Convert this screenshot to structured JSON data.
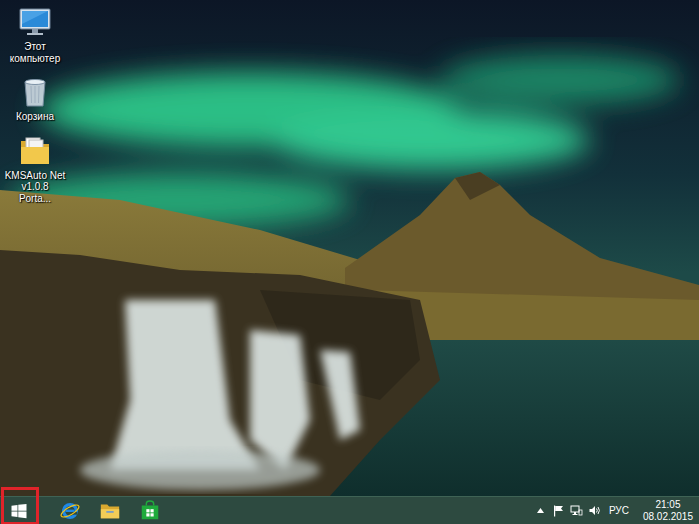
{
  "desktop": {
    "icons": [
      {
        "label": "Этот компьютер",
        "kind": "computer"
      },
      {
        "label": "Корзина",
        "kind": "recycle-bin"
      },
      {
        "label": "KMSAuto Net v1.0.8 Porta...",
        "kind": "folder"
      }
    ]
  },
  "taskbar": {
    "start": {
      "highlighted": true
    },
    "pinned": [
      {
        "kind": "ie"
      },
      {
        "kind": "explorer"
      },
      {
        "kind": "store"
      }
    ]
  },
  "tray": {
    "language": "РУС",
    "time": "21:05",
    "date": "08.02.2015"
  }
}
